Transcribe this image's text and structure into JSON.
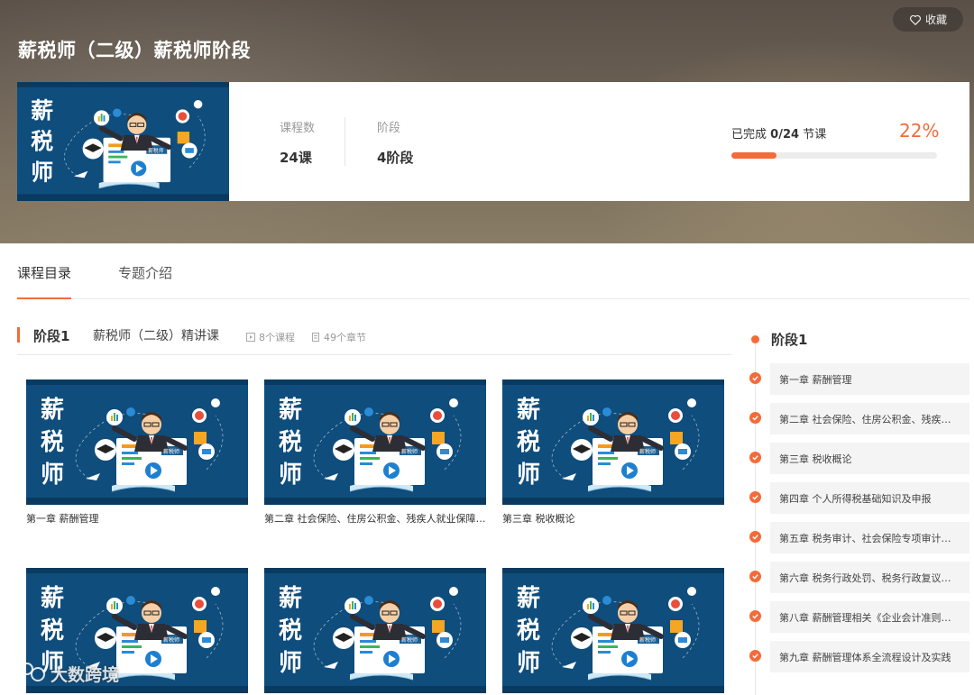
{
  "hero": {
    "title": "薪税师（二级）薪税师阶段",
    "favorite_label": "收藏",
    "thumb_text": [
      "薪",
      "税",
      "师"
    ],
    "thumb_screen_text": "薪税师",
    "stats": [
      {
        "label": "课程数",
        "value": "24课"
      },
      {
        "label": "阶段",
        "value": "4阶段"
      }
    ],
    "progress": {
      "prefix": "已完成",
      "count": "0/24",
      "suffix": "节课",
      "percent_label": "22%",
      "fraction": 0.22
    }
  },
  "tabs": [
    {
      "label": "课程目录",
      "active": true
    },
    {
      "label": "专题介绍",
      "active": false
    }
  ],
  "stage": {
    "number": "阶段1",
    "name": "薪税师（二级）精讲课",
    "courses_count": "8个课程",
    "chapters_count": "49个章节"
  },
  "courses": [
    {
      "title": "第一章 薪酬管理"
    },
    {
      "title": "第二章 社会保险、住房公积金、残疾人就业保障金、工会经费"
    },
    {
      "title": "第三章 税收概论"
    },
    {
      "title": ""
    },
    {
      "title": ""
    },
    {
      "title": ""
    }
  ],
  "sidebar": {
    "heading": "阶段1",
    "items": [
      "第一章 薪酬管理",
      "第二章 社会保险、住房公积金、残疾人就业保障金、工会经费",
      "第三章 税收概论",
      "第四章 个人所得税基础知识及申报",
      "第五章 税务审计、社会保险专项审计与风险管理",
      "第六章 税务行政处罚、税务行政复议、税务行政诉讼",
      "第八章 薪酬管理相关《企业会计准则》及会计处理",
      "第九章 薪酬管理体系全流程设计及实践"
    ]
  },
  "watermark": "大数跨境",
  "colors": {
    "accent": "#f26b3a",
    "thumb_blue": "#1a5a8c"
  }
}
